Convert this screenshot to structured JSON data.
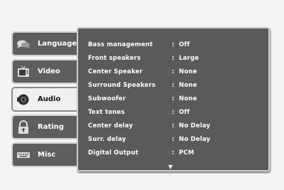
{
  "sidebar": {
    "tabs": [
      {
        "label": "Language",
        "icon": "speech-bubble-icon"
      },
      {
        "label": "Video",
        "icon": "tv-icon"
      },
      {
        "label": "Audio",
        "icon": "speaker-icon"
      },
      {
        "label": "Rating",
        "icon": "padlock-icon"
      },
      {
        "label": "Misc",
        "icon": "keyboard-icon"
      }
    ],
    "selected_index": 2
  },
  "settings": {
    "rows": [
      {
        "name": "Bass management",
        "sep": ":",
        "value": "Off"
      },
      {
        "name": "Front speakers",
        "sep": ":",
        "value": "Large"
      },
      {
        "name": "Center Speaker",
        "sep": ":",
        "value": "None"
      },
      {
        "name": "Surround Speakers",
        "sep": ":",
        "value": "None"
      },
      {
        "name": "Subwoofer",
        "sep": ":",
        "value": "None"
      },
      {
        "name": "Text tones",
        "sep": ":",
        "value": "Off"
      },
      {
        "name": "Center delay",
        "sep": ":",
        "value": "No Delay"
      },
      {
        "name": "Surr. delay",
        "sep": ":",
        "value": "No Delay"
      },
      {
        "name": "Digital Output",
        "sep": ":",
        "value": "PCM"
      }
    ],
    "scroll_indicator": "▼"
  },
  "colors": {
    "panel": "#5a5a5a",
    "tab": "#5e5e5e",
    "tab_selected": "#f0f0f0",
    "text": "#ffffff"
  }
}
